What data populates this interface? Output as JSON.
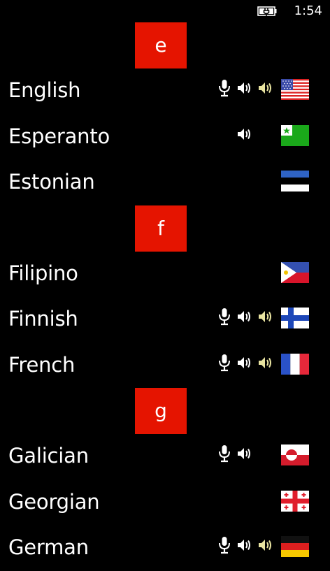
{
  "status_bar": {
    "time": "1:54"
  },
  "sections": [
    {
      "letter": "e",
      "languages": [
        {
          "name": "English",
          "mic": true,
          "speaker": true,
          "speaker_alt": true,
          "flag": "us-flag-icon"
        },
        {
          "name": "Esperanto",
          "mic": false,
          "speaker": true,
          "speaker_alt": false,
          "flag": "esperanto-flag-icon"
        },
        {
          "name": "Estonian",
          "mic": false,
          "speaker": false,
          "speaker_alt": false,
          "flag": "estonia-flag-icon"
        }
      ]
    },
    {
      "letter": "f",
      "languages": [
        {
          "name": "Filipino",
          "mic": false,
          "speaker": false,
          "speaker_alt": false,
          "flag": "philippines-flag-icon"
        },
        {
          "name": "Finnish",
          "mic": true,
          "speaker": true,
          "speaker_alt": true,
          "flag": "finland-flag-icon"
        },
        {
          "name": "French",
          "mic": true,
          "speaker": true,
          "speaker_alt": true,
          "flag": "france-flag-icon"
        }
      ]
    },
    {
      "letter": "g",
      "languages": [
        {
          "name": "Galician",
          "mic": true,
          "speaker": true,
          "speaker_alt": false,
          "flag": "greenland-flag-icon"
        },
        {
          "name": "Georgian",
          "mic": false,
          "speaker": false,
          "speaker_alt": false,
          "flag": "georgia-flag-icon"
        },
        {
          "name": "German",
          "mic": true,
          "speaker": true,
          "speaker_alt": true,
          "flag": "germany-flag-icon"
        }
      ]
    }
  ],
  "colors": {
    "accent": "#e51400",
    "background": "#000000",
    "text": "#ffffff",
    "speaker_alt": "#e8e3a0"
  }
}
